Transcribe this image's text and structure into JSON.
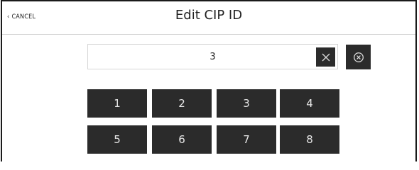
{
  "header": {
    "cancel_label": "CANCEL",
    "title": "Edit CIP ID"
  },
  "input": {
    "value": "3"
  },
  "keypad": {
    "row1": [
      "1",
      "2",
      "3",
      "4"
    ],
    "row2": [
      "5",
      "6",
      "7",
      "8"
    ]
  },
  "icons": {
    "chevron": "chevron-left-icon",
    "clear": "close-icon",
    "backspace": "backspace-circle-icon"
  },
  "colors": {
    "key_background": "#2b2b2b",
    "key_text": "#e6e6e6"
  }
}
